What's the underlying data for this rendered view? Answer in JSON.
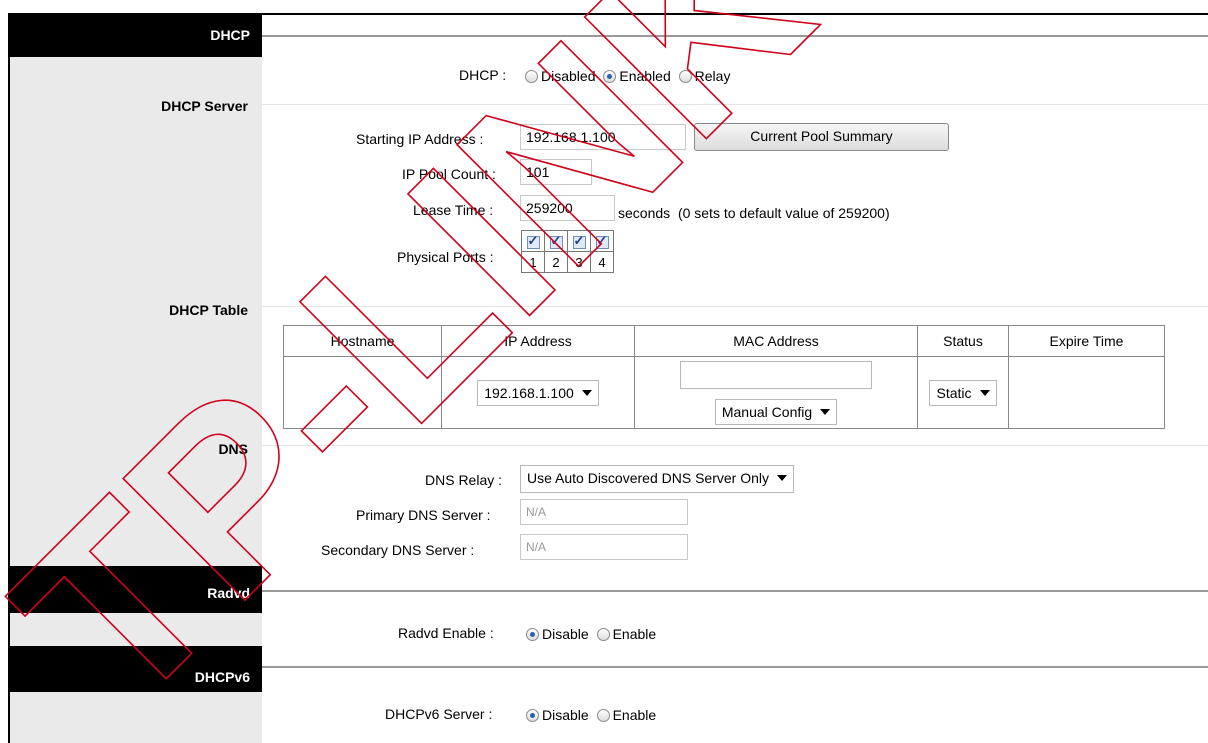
{
  "sections": {
    "dhcp": "DHCP",
    "dhcp_server": "DHCP Server",
    "dhcp_table": "DHCP Table",
    "dns": "DNS",
    "radvd": "Radvd",
    "dhcpv6": "DHCPv6"
  },
  "dhcp_mode": {
    "label": "DHCP :",
    "options": [
      "Disabled",
      "Enabled",
      "Relay"
    ],
    "selected": "Enabled"
  },
  "server": {
    "start_ip_label": "Starting IP Address :",
    "start_ip_value": "192.168.1.100",
    "pool_button": "Current Pool Summary",
    "pool_count_label": "IP Pool Count :",
    "pool_count_value": "101",
    "lease_label": "Lease Time :",
    "lease_value": "259200",
    "lease_unit": "seconds",
    "lease_hint": "(0 sets to default value of 259200)",
    "ports_label": "Physical Ports :",
    "ports": [
      "1",
      "2",
      "3",
      "4"
    ]
  },
  "table": {
    "headers": [
      "Hostname",
      "IP Address",
      "MAC Address",
      "Status",
      "Expire Time"
    ],
    "ip_select": "192.168.1.100",
    "mac_value": "",
    "mac_select": "Manual Config",
    "status_select": "Static"
  },
  "dns": {
    "relay_label": "DNS Relay :",
    "relay_value": "Use Auto Discovered DNS Server Only",
    "primary_label": "Primary DNS Server :",
    "primary_value": "N/A",
    "secondary_label": "Secondary DNS Server :",
    "secondary_value": "N/A"
  },
  "radvd": {
    "label": "Radvd Enable :",
    "options": [
      "Disable",
      "Enable"
    ],
    "selected": "Disable"
  },
  "dhcpv6": {
    "label": "DHCPv6 Server :",
    "options": [
      "Disable",
      "Enable"
    ],
    "selected": "Disable"
  },
  "watermark": "TP-LINK Confidential"
}
